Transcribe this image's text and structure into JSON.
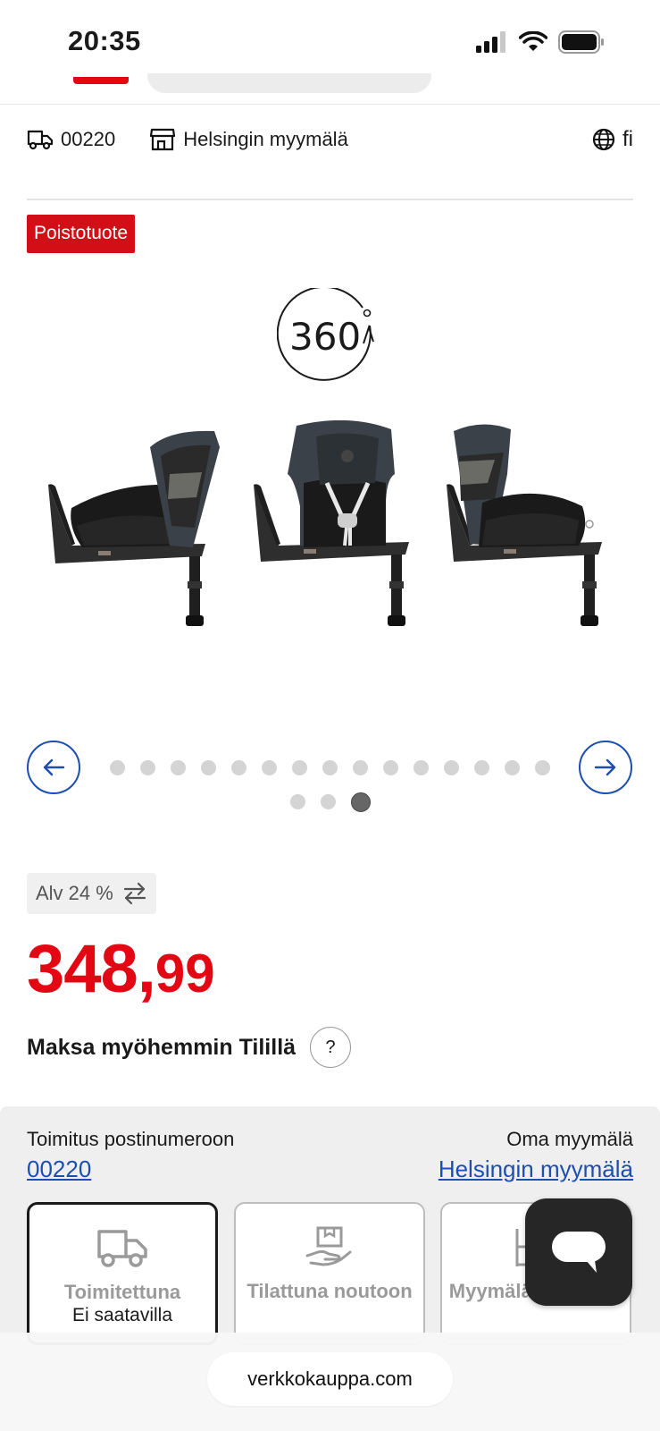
{
  "status_bar": {
    "time": "20:35"
  },
  "info_row": {
    "postal_code": "00220",
    "store": "Helsingin myymälä",
    "language": "fi"
  },
  "badge": "Poistotuote",
  "view_360_label": "360",
  "carousel": {
    "total_images": 17,
    "active_index": 17
  },
  "vat": {
    "label": "Alv 24 %"
  },
  "price": {
    "integer": "348,",
    "decimals": "99"
  },
  "pay_later": {
    "label": "Maksa myöhemmin Tilillä",
    "help": "?"
  },
  "delivery": {
    "postal_label": "Toimitus postinumeroon",
    "postal_value": "00220",
    "store_label": "Oma myymälä",
    "store_value": "Helsingin myymälä",
    "options": [
      {
        "title": "Toimitettuna",
        "subtitle": "Ei saatavilla"
      },
      {
        "title": "Tilattuna noutoon",
        "subtitle": ""
      },
      {
        "title": "Myymälän hyllystä",
        "subtitle": ""
      }
    ]
  },
  "browser": {
    "url": "verkkokauppa.com"
  },
  "colors": {
    "brand_red": "#e30613",
    "link_blue": "#1d4fb0",
    "badge_red": "#d20f16"
  }
}
